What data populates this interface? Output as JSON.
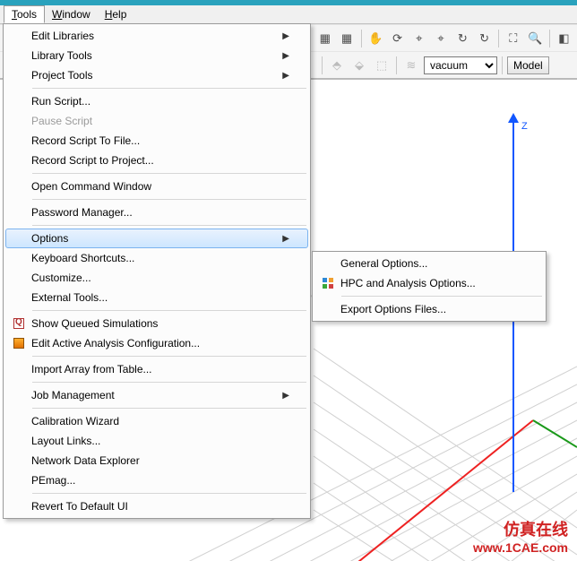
{
  "menubar": {
    "tools": {
      "label": "Tools",
      "u": "T",
      "rest": "ools"
    },
    "window": {
      "label": "Window",
      "u": "W",
      "rest": "indow"
    },
    "help": {
      "label": "Help",
      "u": "H",
      "rest": "elp"
    }
  },
  "toolbar": {
    "material_select": "vacuum",
    "model_button": "Model"
  },
  "toolsMenu": {
    "editLibraries": "Edit Libraries",
    "libraryTools": "Library Tools",
    "projectTools": "Project Tools",
    "runScript": "Run Script...",
    "pauseScript": "Pause Script",
    "recordScriptFile": "Record Script To File...",
    "recordScriptProject": "Record Script to Project...",
    "openCmd": "Open Command Window",
    "passwordMgr": "Password Manager...",
    "options": "Options",
    "keyboard": "Keyboard Shortcuts...",
    "customize": "Customize...",
    "externalTools": "External Tools...",
    "showQueued": "Show Queued Simulations",
    "editActive": "Edit Active Analysis Configuration...",
    "importArray": "Import Array from Table...",
    "jobMgmt": "Job Management",
    "calibWiz": "Calibration Wizard",
    "layoutLinks": "Layout Links...",
    "netExplorer": "Network Data Explorer",
    "pemag": "PEmag...",
    "revert": "Revert To Default UI"
  },
  "optionsSubmenu": {
    "general": "General Options...",
    "hpc": "HPC and Analysis Options...",
    "export": "Export Options Files..."
  },
  "viewport": {
    "z_label": "Z",
    "watermark": "1CAE.com",
    "brand_cn": "仿真在线",
    "brand_en": "www.1CAE.com"
  }
}
